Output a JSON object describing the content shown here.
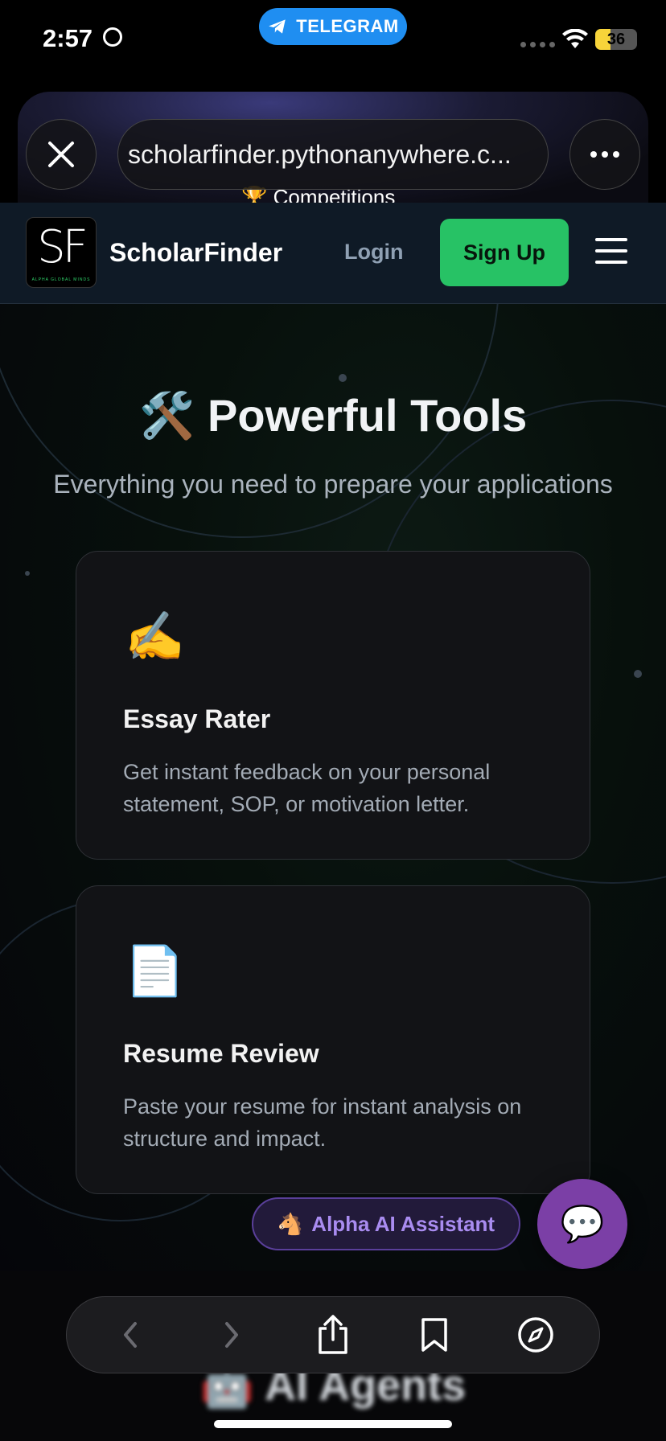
{
  "status_bar": {
    "time": "2:57",
    "telegram_label": "TELEGRAM",
    "battery_level": "36",
    "accent_color": "#1f8ef1"
  },
  "browser": {
    "url": "scholarfinder.pythonanywhere.c...",
    "close_icon": "close-icon",
    "more_icon": "more-icon",
    "behind_text": "🏆 Competitions"
  },
  "site_nav": {
    "logo_text": "SF",
    "logo_tagline": "ALPHA GLOBAL MINDS",
    "brand": "ScholarFinder",
    "login_label": "Login",
    "signup_label": "Sign Up",
    "signup_color": "#27c265"
  },
  "tools_section": {
    "title": "🛠️ Powerful Tools",
    "subtitle": "Everything you need to prepare your applications",
    "cards": [
      {
        "icon": "✍️",
        "title": "Essay Rater",
        "description": "Get instant feedback on your personal statement, SOP, or motivation letter."
      },
      {
        "icon": "📄",
        "title": "Resume Review",
        "description": "Paste your resume for instant analysis on structure and impact."
      }
    ]
  },
  "assistant": {
    "pill_icon": "🐴",
    "pill_label": "Alpha AI Assistant",
    "chat_icon": "💬",
    "fab_color": "#7b3fa6"
  },
  "bottom": {
    "behind_heading": "🤖 AI Agents",
    "toolbar": [
      "back-icon",
      "forward-icon",
      "share-icon",
      "bookmarks-icon",
      "compass-icon"
    ]
  }
}
